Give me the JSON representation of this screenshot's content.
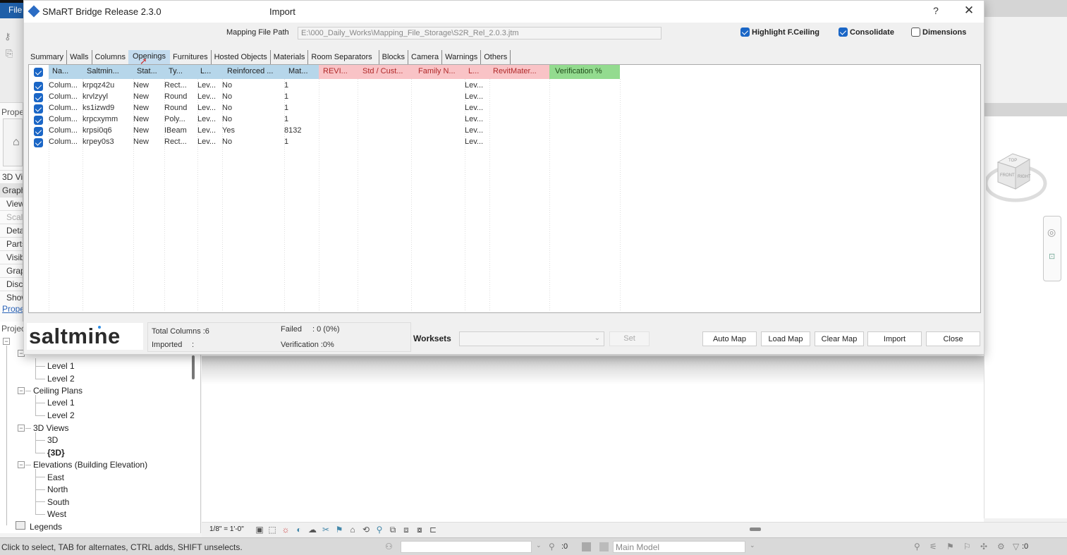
{
  "background_app": {
    "file_tab": "File",
    "properties": {
      "title": "Prope",
      "type_label": "3D Vi",
      "section": "Graph",
      "rows": [
        "View",
        "Scale",
        "Deta",
        "Parts",
        "Visib",
        "Grap",
        "Disc",
        "Show"
      ],
      "link": "Prope"
    },
    "project_browser": {
      "title": "Projec",
      "items": [
        {
          "label": "Level 1",
          "level": 2
        },
        {
          "label": "Level 2",
          "level": 2
        },
        {
          "label": "Ceiling Plans",
          "level": 1
        },
        {
          "label": "Level 1",
          "level": 2
        },
        {
          "label": "Level 2",
          "level": 2
        },
        {
          "label": "3D Views",
          "level": 1
        },
        {
          "label": "3D",
          "level": 2
        },
        {
          "label": "{3D}",
          "level": 2,
          "bold": true
        },
        {
          "label": "Elevations (Building Elevation)",
          "level": 1
        },
        {
          "label": "East",
          "level": 2
        },
        {
          "label": "North",
          "level": 2
        },
        {
          "label": "South",
          "level": 2
        },
        {
          "label": "West",
          "level": 2
        },
        {
          "label": "Legends",
          "level": 0
        }
      ]
    },
    "view_bar": {
      "scale": "1/8\" = 1'-0\""
    },
    "viewcube": {
      "top": "TOP",
      "front": "FRONT",
      "right": "RIGHT"
    },
    "status_bar": {
      "message": "Click to select, TAB for alternates, CTRL adds, SHIFT unselects.",
      "selection_count": ":0",
      "model": "Main Model",
      "filter_count": ":0"
    }
  },
  "dialog": {
    "app_title": "SMaRT Bridge Release 2.3.0",
    "title": "Import",
    "help_label": "?",
    "close_label": "✕",
    "mapping_file_label": "Mapping File Path",
    "mapping_file_path": "E:\\000_Daily_Works\\Mapping_File_Storage\\S2R_Rel_2.0.3.jtm",
    "options": [
      {
        "label": "Highlight  F.Ceiling",
        "checked": true
      },
      {
        "label": "Consolidate",
        "checked": true
      },
      {
        "label": "Dimensions",
        "checked": false
      }
    ],
    "tabs": [
      {
        "label": "Summary"
      },
      {
        "label": "Walls"
      },
      {
        "label": "Columns"
      },
      {
        "label": "Openings",
        "active": true
      },
      {
        "label": "Furnitures"
      },
      {
        "label": "Hosted Objects"
      },
      {
        "label": "Materials"
      },
      {
        "label": "Room Separators"
      },
      {
        "label": "Blocks"
      },
      {
        "label": "Camera"
      },
      {
        "label": "Warnings"
      },
      {
        "label": "Others"
      }
    ],
    "grid": {
      "header_checked": true,
      "columns": [
        {
          "label": "Na...",
          "group": "saltmine"
        },
        {
          "label": "Saltmin...",
          "group": "saltmine"
        },
        {
          "label": "Stat...",
          "group": "saltmine"
        },
        {
          "label": "Ty...",
          "group": "saltmine"
        },
        {
          "label": "L...",
          "group": "saltmine"
        },
        {
          "label": "Reinforced ...",
          "group": "saltmine"
        },
        {
          "label": "Mat...",
          "group": "saltmine"
        },
        {
          "label": "REVI...",
          "group": "revit"
        },
        {
          "label": "Std / Cust...",
          "group": "revit"
        },
        {
          "label": "Family N...",
          "group": "revit"
        },
        {
          "label": "L...",
          "group": "revit"
        },
        {
          "label": "RevitMater...",
          "group": "revit"
        },
        {
          "label": "Verification %",
          "group": "verification"
        }
      ],
      "rows": [
        {
          "checked": true,
          "cells": [
            "Colum...",
            "krpqz42u",
            "New",
            "Rect...",
            "Lev...",
            "No",
            "1",
            "",
            "",
            "",
            "Lev...",
            "",
            ""
          ]
        },
        {
          "checked": true,
          "cells": [
            "Colum...",
            "krvlzyyl",
            "New",
            "Round",
            "Lev...",
            "No",
            "1",
            "",
            "",
            "",
            "Lev...",
            "",
            ""
          ]
        },
        {
          "checked": true,
          "cells": [
            "Colum...",
            "ks1izwd9",
            "New",
            "Round",
            "Lev...",
            "No",
            "1",
            "",
            "",
            "",
            "Lev...",
            "",
            ""
          ]
        },
        {
          "checked": true,
          "cells": [
            "Colum...",
            "krpcxymm",
            "New",
            "Poly...",
            "Lev...",
            "No",
            "1",
            "",
            "",
            "",
            "Lev...",
            "",
            ""
          ]
        },
        {
          "checked": true,
          "cells": [
            "Colum...",
            "krpsi0q6",
            "New",
            "IBeam",
            "Lev...",
            "Yes",
            "8132",
            "",
            "",
            "",
            "Lev...",
            "",
            ""
          ]
        },
        {
          "checked": true,
          "cells": [
            "Colum...",
            "krpey0s3",
            "New",
            "Rect...",
            "Lev...",
            "No",
            "1",
            "",
            "",
            "",
            "Lev...",
            "",
            ""
          ]
        }
      ]
    },
    "footer": {
      "logo": "saltmine",
      "total_label": "Total Columns :6",
      "imported_label": "Imported",
      "imported_value": ":",
      "failed_label": "Failed",
      "failed_value": ": 0 (0%)",
      "verification_label": "Verification :0%",
      "worksets_label": "Worksets",
      "worksets_value": "",
      "set_label": "Set",
      "buttons": [
        "Auto Map",
        "Load Map",
        "Clear Map",
        "Import",
        "Close"
      ]
    },
    "colors": {
      "saltmine_header": "#b6d6ea",
      "revit_header": "#f9c3c6",
      "verification_header": "#93db8f",
      "checkbox": "#1a66c6"
    }
  }
}
